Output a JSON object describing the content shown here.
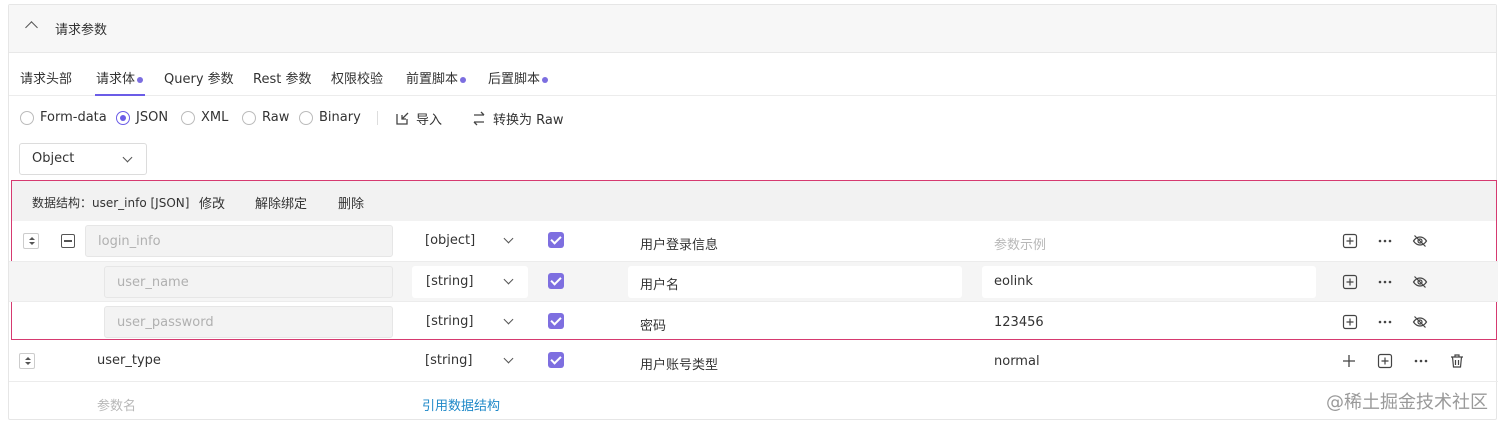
{
  "panel": {
    "title": "请求参数"
  },
  "tabs": [
    {
      "label": "请求头部",
      "dot": false
    },
    {
      "label": "请求体",
      "dot": true,
      "active": true
    },
    {
      "label": "Query 参数",
      "dot": false
    },
    {
      "label": "Rest 参数",
      "dot": false
    },
    {
      "label": "权限校验",
      "dot": false
    },
    {
      "label": "前置脚本",
      "dot": true
    },
    {
      "label": "后置脚本",
      "dot": true
    }
  ],
  "formats": [
    {
      "label": "Form-data",
      "checked": false
    },
    {
      "label": "JSON",
      "checked": true
    },
    {
      "label": "XML",
      "checked": false
    },
    {
      "label": "Raw",
      "checked": false
    },
    {
      "label": "Binary",
      "checked": false
    }
  ],
  "actions": {
    "import_label": "导入",
    "convert_label": "转换为 Raw"
  },
  "root_type": "Object",
  "struct": {
    "label": "数据结构：user_info [JSON]",
    "edit": "修改",
    "unbind": "解除绑定",
    "delete": "删除"
  },
  "rows": [
    {
      "name": "login_info",
      "type": "[object]",
      "required": true,
      "desc": "用户登录信息",
      "example": "",
      "example_placeholder": "参数示例"
    },
    {
      "name": "user_name",
      "type": "[string]",
      "required": true,
      "desc": "用户名",
      "example": "eolink"
    },
    {
      "name": "user_password",
      "type": "[string]",
      "required": true,
      "desc": "密码",
      "example": "123456"
    },
    {
      "name": "user_type",
      "type": "[string]",
      "required": true,
      "desc": "用户账号类型",
      "example": "normal"
    }
  ],
  "new_row": {
    "name_placeholder": "参数名",
    "ref_link": "引用数据结构"
  },
  "watermark": "@稀土掘金技术社区",
  "colors": {
    "accent": "#6b5ce7",
    "struct_border": "#d63a70",
    "link": "#1e88c8"
  }
}
